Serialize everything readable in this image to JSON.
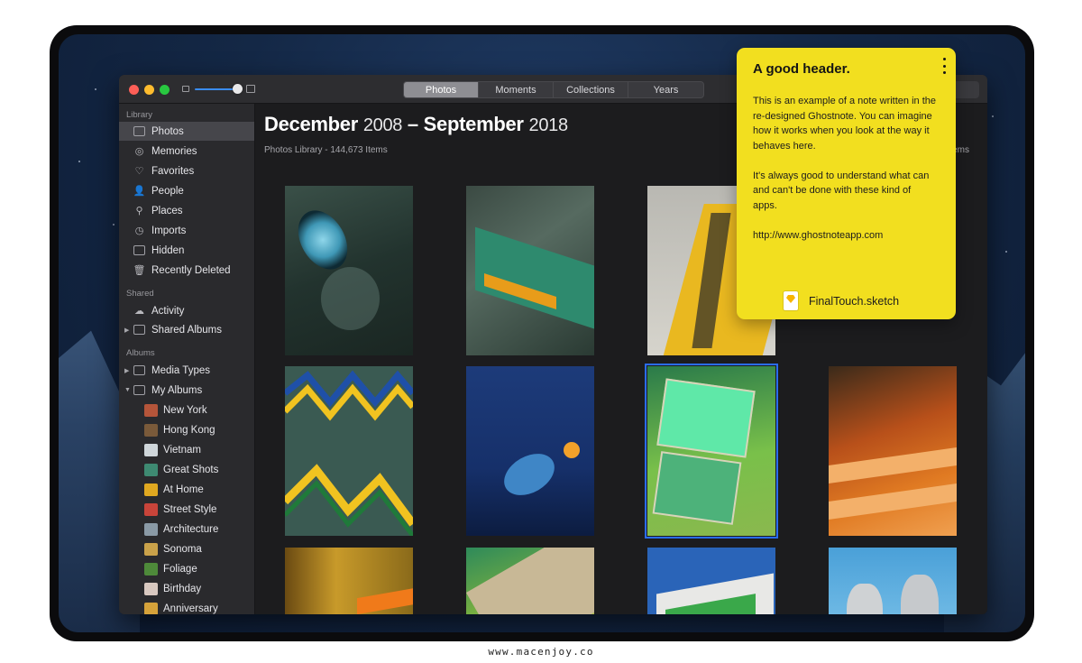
{
  "toolbar": {
    "tabs": [
      {
        "label": "Photos",
        "active": true
      },
      {
        "label": "Moments",
        "active": false
      },
      {
        "label": "Collections",
        "active": false
      },
      {
        "label": "Years",
        "active": false
      }
    ]
  },
  "sidebar": {
    "library_label": "Library",
    "library_items": [
      {
        "label": "Photos",
        "icon": "photos-icon",
        "selected": true
      },
      {
        "label": "Memories",
        "icon": "memories-icon"
      },
      {
        "label": "Favorites",
        "icon": "heart-icon"
      },
      {
        "label": "People",
        "icon": "person-icon"
      },
      {
        "label": "Places",
        "icon": "pin-icon"
      },
      {
        "label": "Imports",
        "icon": "clock-icon"
      },
      {
        "label": "Hidden",
        "icon": "hidden-icon"
      },
      {
        "label": "Recently Deleted",
        "icon": "trash-icon"
      }
    ],
    "shared_label": "Shared",
    "shared_items": [
      {
        "label": "Activity",
        "icon": "cloud-icon"
      },
      {
        "label": "Shared Albums",
        "icon": "album-folder-icon"
      }
    ],
    "albums_label": "Albums",
    "album_groups": [
      {
        "label": "Media Types",
        "icon": "folder-icon"
      },
      {
        "label": "My Albums",
        "icon": "folder-icon"
      }
    ],
    "my_albums": [
      {
        "label": "New York",
        "color": "#b5553a"
      },
      {
        "label": "Hong Kong",
        "color": "#7a5a3a"
      },
      {
        "label": "Vietnam",
        "color": "#cfd6da"
      },
      {
        "label": "Great Shots",
        "color": "#3e8a72"
      },
      {
        "label": "At Home",
        "color": "#e0a820"
      },
      {
        "label": "Street Style",
        "color": "#c8443a"
      },
      {
        "label": "Architecture",
        "color": "#8a9aa6"
      },
      {
        "label": "Sonoma",
        "color": "#caa24a"
      },
      {
        "label": "Foliage",
        "color": "#4e8a3a"
      },
      {
        "label": "Birthday",
        "color": "#d8c8c0"
      },
      {
        "label": "Anniversary",
        "color": "#d6a23a"
      }
    ]
  },
  "main": {
    "title_month_start": "December",
    "title_year_start": "2008",
    "title_dash": " – ",
    "title_month_end": "September",
    "title_year_end": "2018",
    "subtitle": "Photos Library - 144,673 Items",
    "all_items": "All Items"
  },
  "note": {
    "title": "A good header.",
    "paragraphs": [
      "This is an example of a note written in the re-designed Ghostnote. You can imagine how it works when you look at the way it behaves here.",
      "It's always good to understand what can and can't be done with these kind of apps.",
      "http://www.ghostnoteapp.com"
    ],
    "attachment": "FinalTouch.sketch"
  },
  "footer": {
    "watermark": "www.macenjoy.co"
  }
}
